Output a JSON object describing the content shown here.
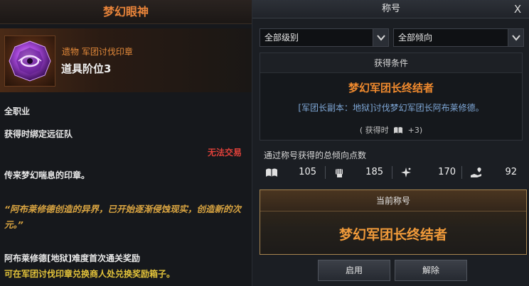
{
  "item_tooltip": {
    "name": "梦幻眼神",
    "category": "遗物 军团讨伐印章",
    "tier": "道具阶位3",
    "class": "全职业",
    "binding": "获得时绑定远征队",
    "trade_status": "无法交易",
    "description": "传来梦幻喘息的印章。",
    "lore_quote": "“阿布莱修德创造的异界，已开始逐渐侵蚀现实，创造新的次元。”",
    "reward_title": "阿布莱修德[地狱]难度首次通关奖励",
    "reward_desc": "可在军团讨伐印章兑换商人处兑换奖励箱子。",
    "icon": "purple-seal-gem-icon"
  },
  "title_window": {
    "window_title": "称号",
    "close_glyph": "X",
    "filters": {
      "grade": "全部级别",
      "tendency": "全部倾向"
    },
    "condition": {
      "heading": "获得条件",
      "title_name": "梦幻军团长终结者",
      "description": "[军团长副本：地狱]讨伐梦幻军团长阿布莱修德。",
      "reward_prefix": "( 获得时",
      "reward_value": "+3)",
      "reward_icon": "book-icon"
    },
    "points_label": "通过称号获得的总倾向点数",
    "stats": [
      {
        "icon": "book-icon",
        "value": "105"
      },
      {
        "icon": "fist-icon",
        "value": "185"
      },
      {
        "icon": "sparkle-icon",
        "value": "170"
      },
      {
        "icon": "heart-hand-icon",
        "value": "92"
      }
    ],
    "current": {
      "heading": "当前称号",
      "title_name": "梦幻军团长终结者"
    },
    "buttons": {
      "equip": "启用",
      "remove": "解除"
    }
  },
  "colors": {
    "accent_orange": "#f08a2e",
    "quote_gold": "#d9a441",
    "reward_yellow": "#e2c23a",
    "warning_red": "#e0413a",
    "desc_blue": "#7fa8d8"
  }
}
